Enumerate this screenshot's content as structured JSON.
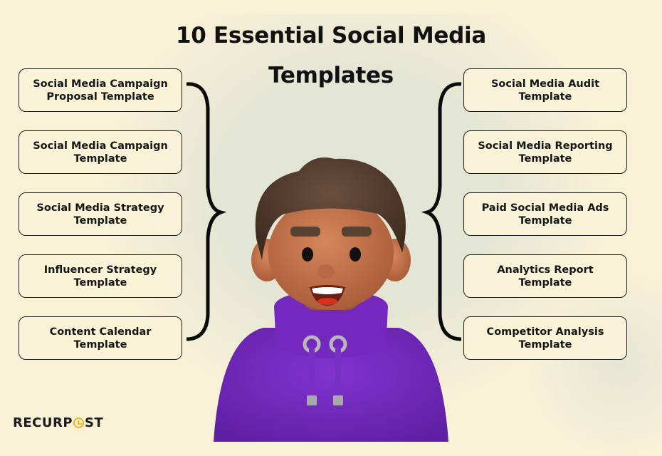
{
  "title": "10 Essential Social Media Templates",
  "left_items": [
    {
      "label": "Social Media Campaign\nProposal Template"
    },
    {
      "label": "Social Media Campaign\nTemplate"
    },
    {
      "label": "Social Media Strategy\nTemplate"
    },
    {
      "label": "Influencer Strategy\nTemplate"
    },
    {
      "label": "Content Calendar\nTemplate"
    }
  ],
  "right_items": [
    {
      "label": "Social Media Audit\nTemplate"
    },
    {
      "label": "Social Media Reporting\nTemplate"
    },
    {
      "label": "Paid Social Media Ads\nTemplate"
    },
    {
      "label": "Analytics Report\nTemplate"
    },
    {
      "label": "Competitor Analysis\nTemplate"
    }
  ],
  "logo": {
    "part1": "RECURP",
    "part2": "ST",
    "icon": "clock-icon"
  },
  "colors": {
    "background": "#f8f1d6",
    "hoodie": "#7a2fc4",
    "skin": "#c7764e",
    "hair": "#5a4233",
    "logo_accent": "#f3b51b"
  }
}
